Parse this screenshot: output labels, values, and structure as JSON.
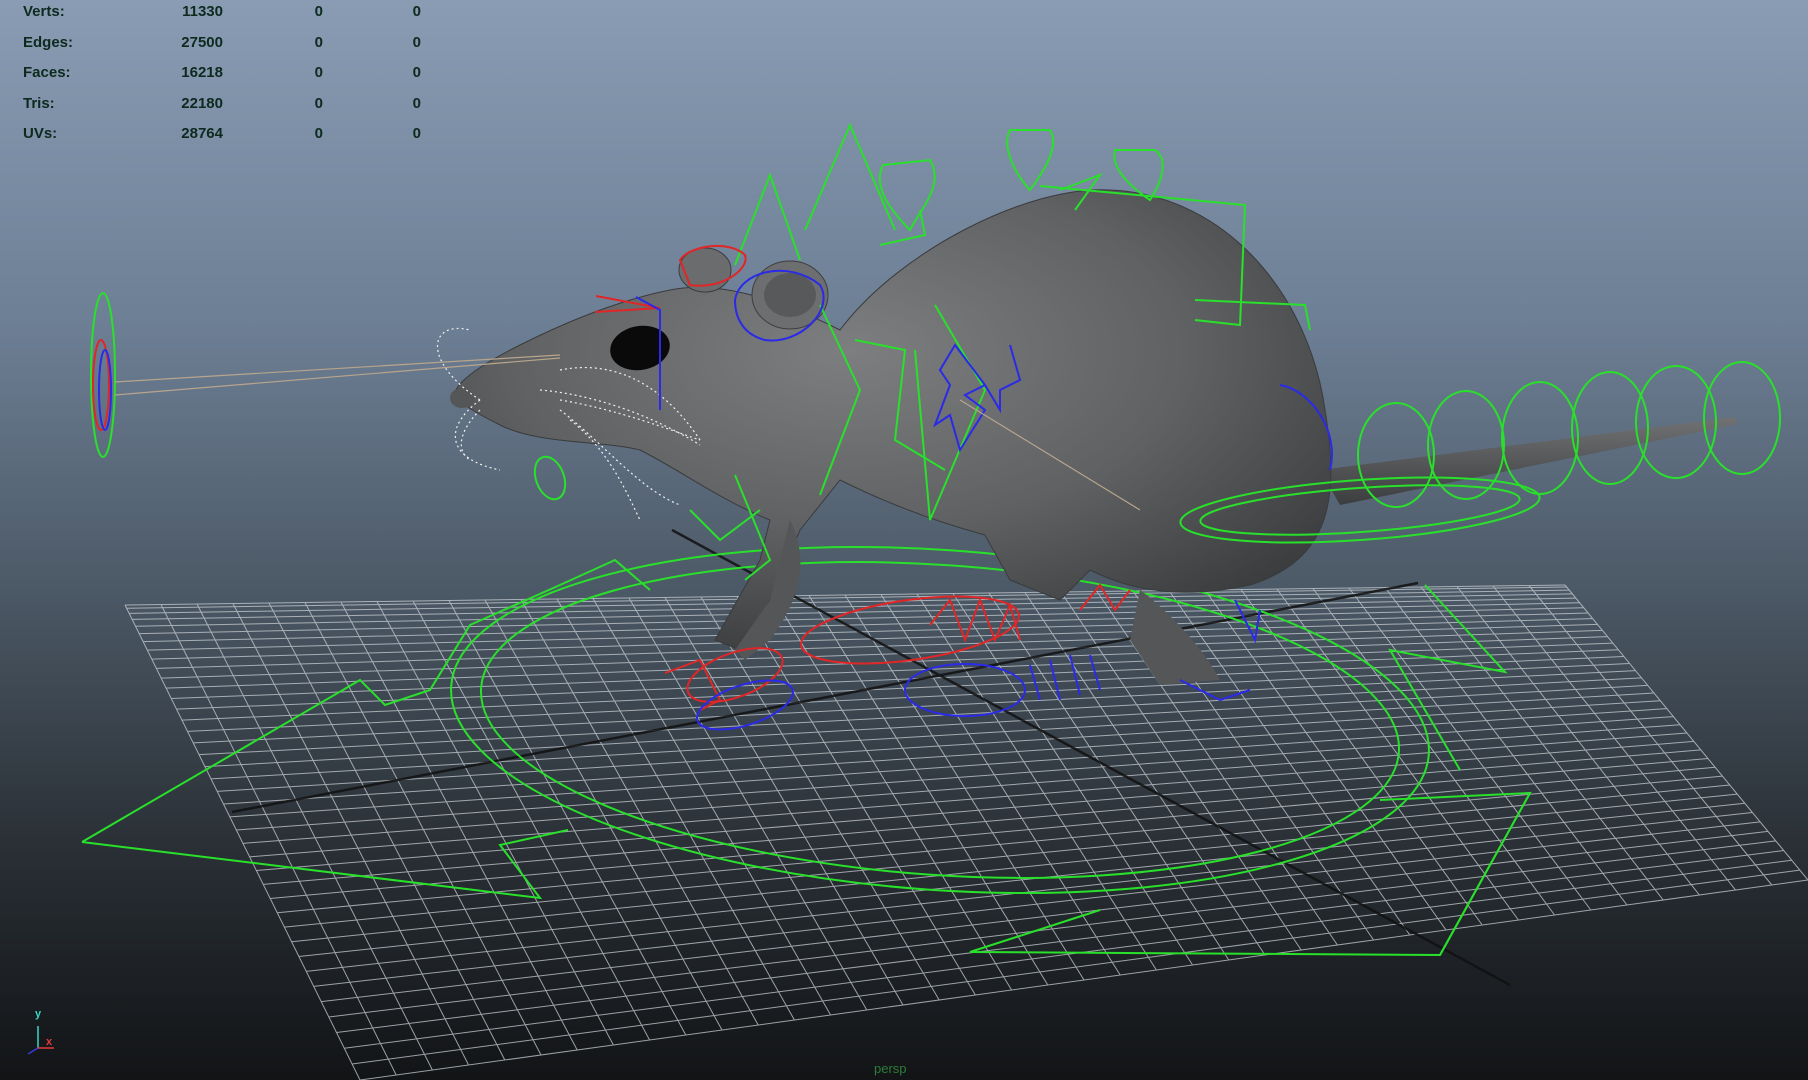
{
  "viewport": {
    "background_top": "#8a9cb3",
    "background_bottom": "#121416",
    "camera_name": "persp"
  },
  "hud": {
    "rows": [
      {
        "label": "Verts:",
        "v1": "11330",
        "v2": "0",
        "v3": "0"
      },
      {
        "label": "Edges:",
        "v1": "27500",
        "v2": "0",
        "v3": "0"
      },
      {
        "label": "Faces:",
        "v1": "16218",
        "v2": "0",
        "v3": "0"
      },
      {
        "label": "Tris:",
        "v1": "22180",
        "v2": "0",
        "v3": "0"
      },
      {
        "label": "UVs:",
        "v1": "28764",
        "v2": "0",
        "v3": "0"
      }
    ]
  },
  "axis_gizmo": {
    "y_label": "y",
    "x_label": "x"
  },
  "colors": {
    "controls_primary": "#29e02b",
    "controls_left": "#e02626",
    "controls_right": "#2a2ae8",
    "mesh": "#5f6163",
    "grid": "#c9cfd4",
    "grid_axis": "#111111"
  }
}
